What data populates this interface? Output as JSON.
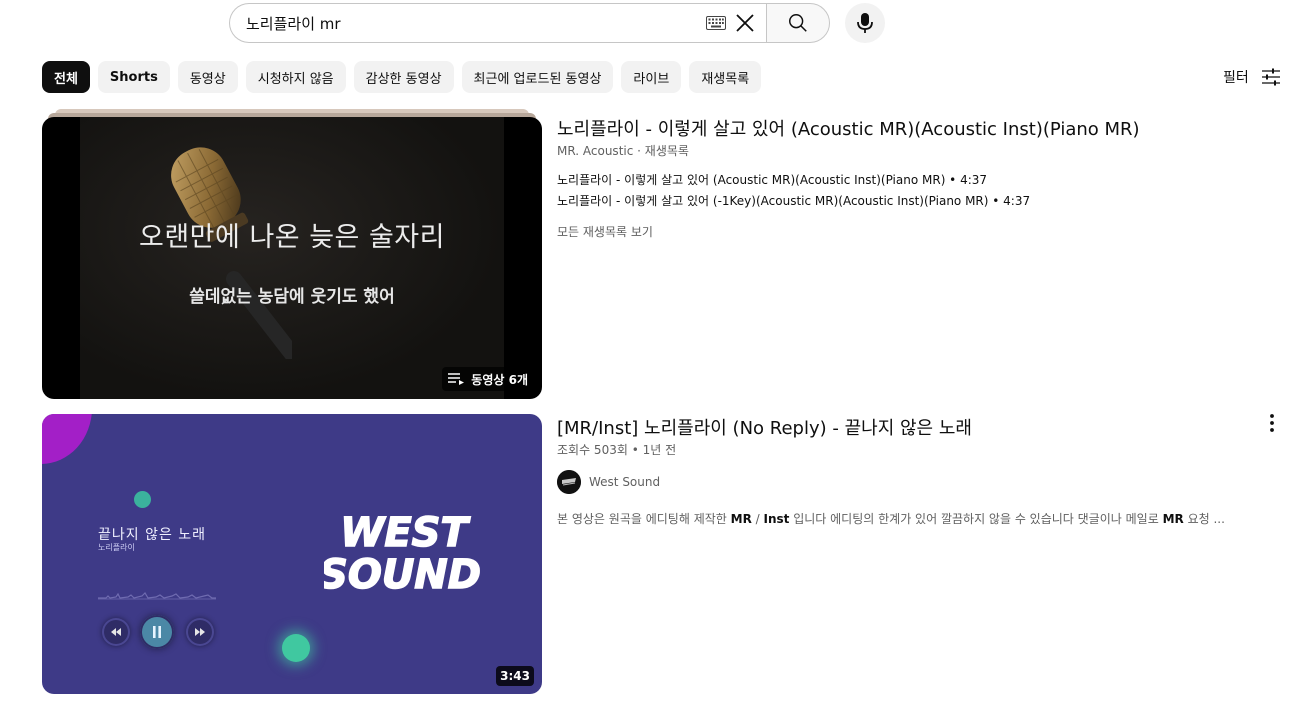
{
  "search": {
    "value": "노리플라이 mr",
    "icons": {
      "keyboard": "keyboard-icon",
      "clear": "close-icon",
      "search": "search-icon",
      "mic": "mic-icon"
    }
  },
  "chips": [
    {
      "label": "전체",
      "active": true
    },
    {
      "label": "Shorts"
    },
    {
      "label": "동영상"
    },
    {
      "label": "시청하지 않음"
    },
    {
      "label": "감상한 동영상"
    },
    {
      "label": "최근에 업로드된 동영상"
    },
    {
      "label": "라이브"
    },
    {
      "label": "재생목록"
    }
  ],
  "filter": {
    "label": "필터",
    "icon": "sliders-icon"
  },
  "results": [
    {
      "kind": "playlist",
      "title": "노리플라이 - 이렇게 살고 있어 (Acoustic MR)(Acoustic Inst)(Piano MR)",
      "channel": "MR. Acoustic",
      "meta_suffix": "재생목록",
      "thumbnail": {
        "lyric_main": "오랜만에 나온 늦은 술자리",
        "lyric_sub": "쓸데없는 농담에 웃기도 했어",
        "badge": "동영상 6개"
      },
      "items": [
        "노리플라이 - 이렇게 살고 있어 (Acoustic MR)(Acoustic Inst)(Piano MR) • 4:37",
        "노리플라이 - 이렇게 살고 있어 (-1Key)(Acoustic MR)(Acoustic Inst)(Piano MR) • 4:37"
      ],
      "view_all": "모든 재생목록 보기"
    },
    {
      "kind": "video",
      "title": "[MR/Inst] 노리플라이 (No Reply) - 끝나지 않은 노래",
      "meta": "조회수 503회 • 1년 전",
      "channel": "West Sound",
      "duration": "3:43",
      "thumbnail": {
        "song_name": "끝나지 않은 노래",
        "song_artist": "노리플라이",
        "brand_line1": "WEST",
        "brand_line2": "SOUND"
      },
      "desc": {
        "p1": "본 영상은 원곡을 에디팅해 제작한 ",
        "b1": "MR",
        "p2": " / ",
        "b2": "Inst",
        "p3": " 입니다 에디팅의 한계가 있어 깔끔하지 않을 수 있습니다 댓글이나 메일로 ",
        "b3": "MR",
        "p4": " 요청 ..."
      }
    }
  ],
  "colors": {
    "accent": "#0f0f0f",
    "chip_bg": "#f2f2f2",
    "secondary_text": "#606060",
    "thumb2_bg": "#3e3a87"
  }
}
